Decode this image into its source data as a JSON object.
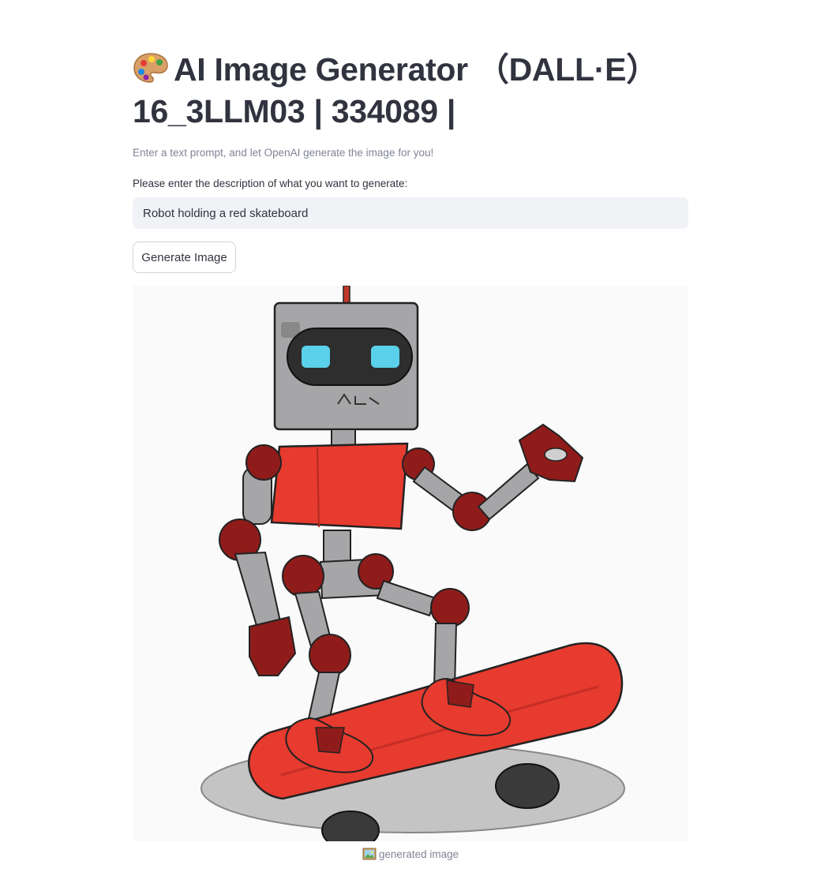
{
  "header": {
    "title": "AI Image Generator （DALL·E）16_3LLM03 | 334089 |",
    "title_icon": "artist-palette-icon",
    "subtitle": "Enter a text prompt, and let OpenAI generate the image for you!"
  },
  "prompt": {
    "label": "Please enter the description of what you want to generate:",
    "value": "Robot holding a red skateboard"
  },
  "actions": {
    "generate_label": "Generate Image"
  },
  "result": {
    "image_subject": "cartoon robot riding a red skateboard",
    "caption_icon": "framed-picture-icon",
    "caption": "generated image"
  },
  "colors": {
    "text": "#31333f",
    "muted": "#808495",
    "input_bg": "#f0f2f6",
    "robot_red": "#e63b2e",
    "robot_dark_red": "#8f1c1a",
    "robot_gray": "#a6a6a8"
  }
}
